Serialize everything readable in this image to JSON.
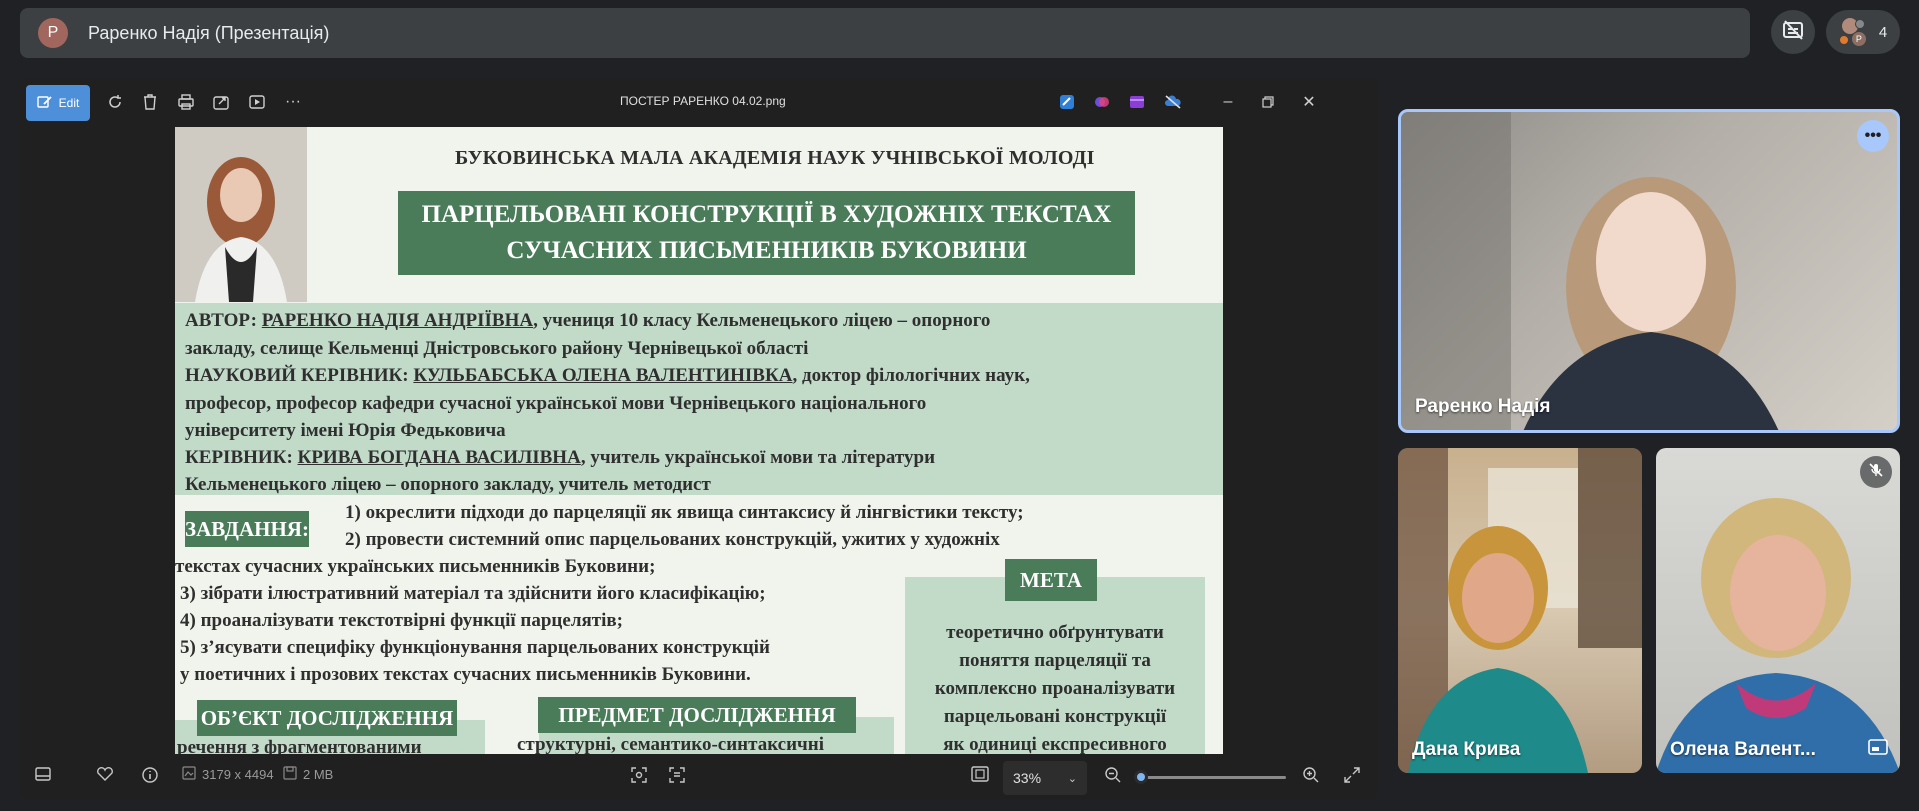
{
  "meeting": {
    "presenter_initial": "P",
    "title": "Раренко Надія (Презентація)",
    "participants_count": "4",
    "participant_avatar_initial": "P"
  },
  "viewer": {
    "edit_label": "Edit",
    "filename": "ПОСТЕР РАРЕНКО 04.02.png",
    "dimensions": "3179 x 4494",
    "size": "2 MB",
    "zoom": "33%",
    "zoom_level": 0.02
  },
  "poster": {
    "org": "БУКОВИНСЬКА МАЛА АКАДЕМІЯ НАУК УЧНІВСЬКОЇ МОЛОДІ",
    "title_line1": "ПАРЦЕЛЬОВАНІ КОНСТРУКЦІЇ В ХУДОЖНІХ ТЕКСТАХ",
    "title_line2": "СУЧАСНИХ ПИСЬМЕННИКІВ БУКОВИНИ",
    "author_label": "АВТОР: ",
    "author_name": "РАРЕНКО НАДІЯ АНДРІЇВНА",
    "author_rest": ", учениця 10 класу  Кельменецького ліцею – опорного",
    "author_line2": "закладу, селище Кельменці Дністровського району Чернівецької області",
    "supervisor_label": "НАУКОВИЙ КЕРІВНИК: ",
    "supervisor_name": "КУЛЬБАБСЬКА ОЛЕНА ВАЛЕНТИНІВКА",
    "supervisor_rest": ", доктор філологічних наук,",
    "supervisor_line2": "професор, професор кафедри сучасної української мови Чернівецького національного",
    "supervisor_line3": "університету імені Юрія Федьковича",
    "leader_label": "КЕРІВНИК: ",
    "leader_name": "КРИВА БОГДАНА ВАСИЛІВНА",
    "leader_rest": ", учитель української мови та літератури",
    "leader_line2": "Кельменецького ліцею – опорного закладу, учитель методист",
    "tasks_label": "ЗАВДАННЯ:",
    "task1": "1) окреслити підходи до парцеляції як явища синтаксису й лінгвістики тексту;",
    "task2": "2) провести системний опис парцельованих конструкцій, ужитих у художніх",
    "task2b": "текстах сучасних українських письменників Буковини;",
    "task3": "3) зібрати ілюстративний матеріал та здійснити його класифікацію;",
    "task4": "4) проаналізувати текстотвірні функції парцелятів;",
    "task5": "5) з’ясувати специфіку функціонування парцельованих конструкцій",
    "task5b": "у поетичних і прозових текстах сучасних письменників Буковини.",
    "goal_label": "МЕТА",
    "goal_line1": "теоретично обґрунтувати",
    "goal_line2": "поняття парцеляції та",
    "goal_line3": "комплексно проаналізувати",
    "goal_line4": "парцельовані конструкції",
    "goal_line5": "як одиниці експресивного",
    "object_label": "ОБ’ЄКТ ДОСЛІДЖЕННЯ",
    "object_text": "речення з фрагментованими",
    "subject_label": "ПРЕДМЕТ ДОСЛІДЖЕННЯ",
    "subject_text": "структурні, семантико-синтаксичні"
  },
  "participants": [
    {
      "name": "Раренко Надія"
    },
    {
      "name": "Дана Крива"
    },
    {
      "name": "Олена Валент..."
    }
  ],
  "colors": {
    "poster_green": "#4a7c5a",
    "poster_band": "#c2dbc9",
    "accent_blue": "#4d8fd9",
    "active_speaker_border": "#a8c7fa"
  }
}
